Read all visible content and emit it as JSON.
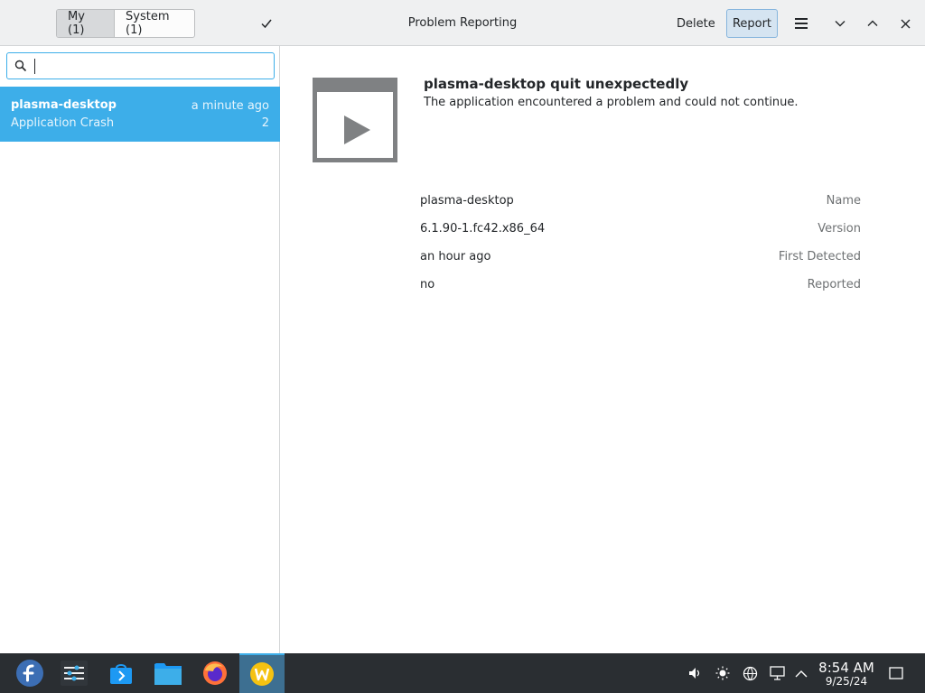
{
  "header": {
    "tabs": [
      {
        "label": "My (1)",
        "active": true
      },
      {
        "label": "System (1)",
        "active": false
      }
    ],
    "title": "Problem Reporting",
    "delete_label": "Delete",
    "report_label": "Report",
    "icons": [
      "checkmark-icon",
      "hamburger-menu-icon",
      "minimize-icon",
      "maximize-icon",
      "close-icon"
    ]
  },
  "sidebar": {
    "search": {
      "value": "",
      "placeholder": ""
    },
    "items": [
      {
        "name": "plasma-desktop",
        "type": "Application Crash",
        "time": "a minute ago",
        "count": "2",
        "selected": true
      }
    ]
  },
  "detail": {
    "title": "plasma-desktop quit unexpectedly",
    "subtitle": "The application encountered a problem and could not continue.",
    "fields": [
      {
        "label": "Name",
        "value": "plasma-desktop"
      },
      {
        "label": "Version",
        "value": "6.1.90-1.fc42.x86_64"
      },
      {
        "label": "First Detected",
        "value": "an hour ago"
      },
      {
        "label": "Reported",
        "value": "no"
      }
    ]
  },
  "taskbar": {
    "apps": [
      "fedora-launcher-icon",
      "system-settings-icon",
      "discover-store-icon",
      "file-manager-icon",
      "firefox-icon",
      "problem-reporting-icon"
    ],
    "tray": [
      "volume-icon",
      "brightness-icon",
      "network-icon",
      "display-icon",
      "tray-expand-icon"
    ],
    "clock_time": "8:54 AM",
    "clock_date": "9/25/24"
  },
  "colors": {
    "accent": "#3daee9",
    "taskbar_bg": "#2a2e32",
    "header_bg": "#eff0f1"
  }
}
